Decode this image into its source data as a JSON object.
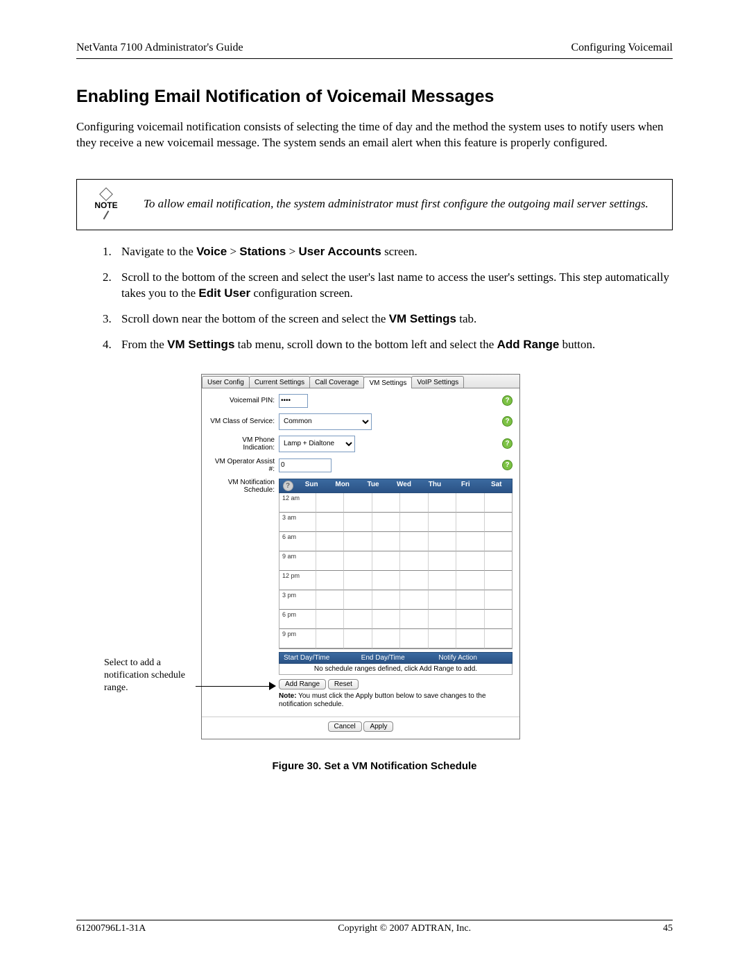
{
  "header": {
    "left": "NetVanta 7100 Administrator's Guide",
    "right": "Configuring Voicemail"
  },
  "title": "Enabling Email Notification of Voicemail Messages",
  "intro": "Configuring voicemail notification consists of selecting the time of day and the method the system uses to notify users when they receive a new voicemail message. The system sends an email alert when this feature is properly configured.",
  "note": {
    "icon_label": "NOTE",
    "text": "To allow email notification, the system administrator must first configure the outgoing mail server settings."
  },
  "steps": {
    "s1_pre": "Navigate to the ",
    "s1_b1": "Voice",
    "s1_mid1": " > ",
    "s1_b2": "Stations",
    "s1_mid2": " > ",
    "s1_b3": "User Accounts",
    "s1_post": " screen.",
    "s2_pre": "Scroll to the bottom of the screen and select the user's last name to access the user's settings. This step automatically takes you to the ",
    "s2_b1": "Edit User",
    "s2_post": " configuration screen.",
    "s3_pre": "Scroll down near the bottom of the screen and select the ",
    "s3_b1": "VM Settings",
    "s3_post": " tab.",
    "s4_pre": "From the ",
    "s4_b1": "VM Settings",
    "s4_mid": " tab menu, scroll down to the bottom left and select the ",
    "s4_b2": "Add Range",
    "s4_post": " button."
  },
  "callout": "Select to add a notification schedule range.",
  "app": {
    "tabs": [
      "User Config",
      "Current Settings",
      "Call Coverage",
      "VM Settings",
      "VoIP Settings"
    ],
    "active_tab": 3,
    "fields": {
      "pin_label": "Voicemail PIN:",
      "pin_value": "••••",
      "cos_label": "VM Class of Service:",
      "cos_value": "Common",
      "phone_label": "VM Phone Indication:",
      "phone_value": "Lamp + Dialtone",
      "assist_label": "VM Operator Assist #:",
      "assist_value": "0",
      "sched_label": "VM Notification Schedule:"
    },
    "days": [
      "Sun",
      "Mon",
      "Tue",
      "Wed",
      "Thu",
      "Fri",
      "Sat"
    ],
    "times": [
      "12 am",
      "3 am",
      "6 am",
      "9 am",
      "12 pm",
      "3 pm",
      "6 pm",
      "9 pm"
    ],
    "range_headers": [
      "Start Day/Time",
      "End Day/Time",
      "Notify Action"
    ],
    "range_empty": "No schedule ranges defined, click Add Range to add.",
    "add_range": "Add Range",
    "reset": "Reset",
    "note_bold": "Note:",
    "note_rest": " You must click the Apply button below to save changes to the notification schedule.",
    "cancel": "Cancel",
    "apply": "Apply"
  },
  "figure_caption": "Figure 30.  Set a VM Notification Schedule",
  "footer": {
    "left": "61200796L1-31A",
    "center": "Copyright © 2007 ADTRAN, Inc.",
    "right": "45"
  }
}
